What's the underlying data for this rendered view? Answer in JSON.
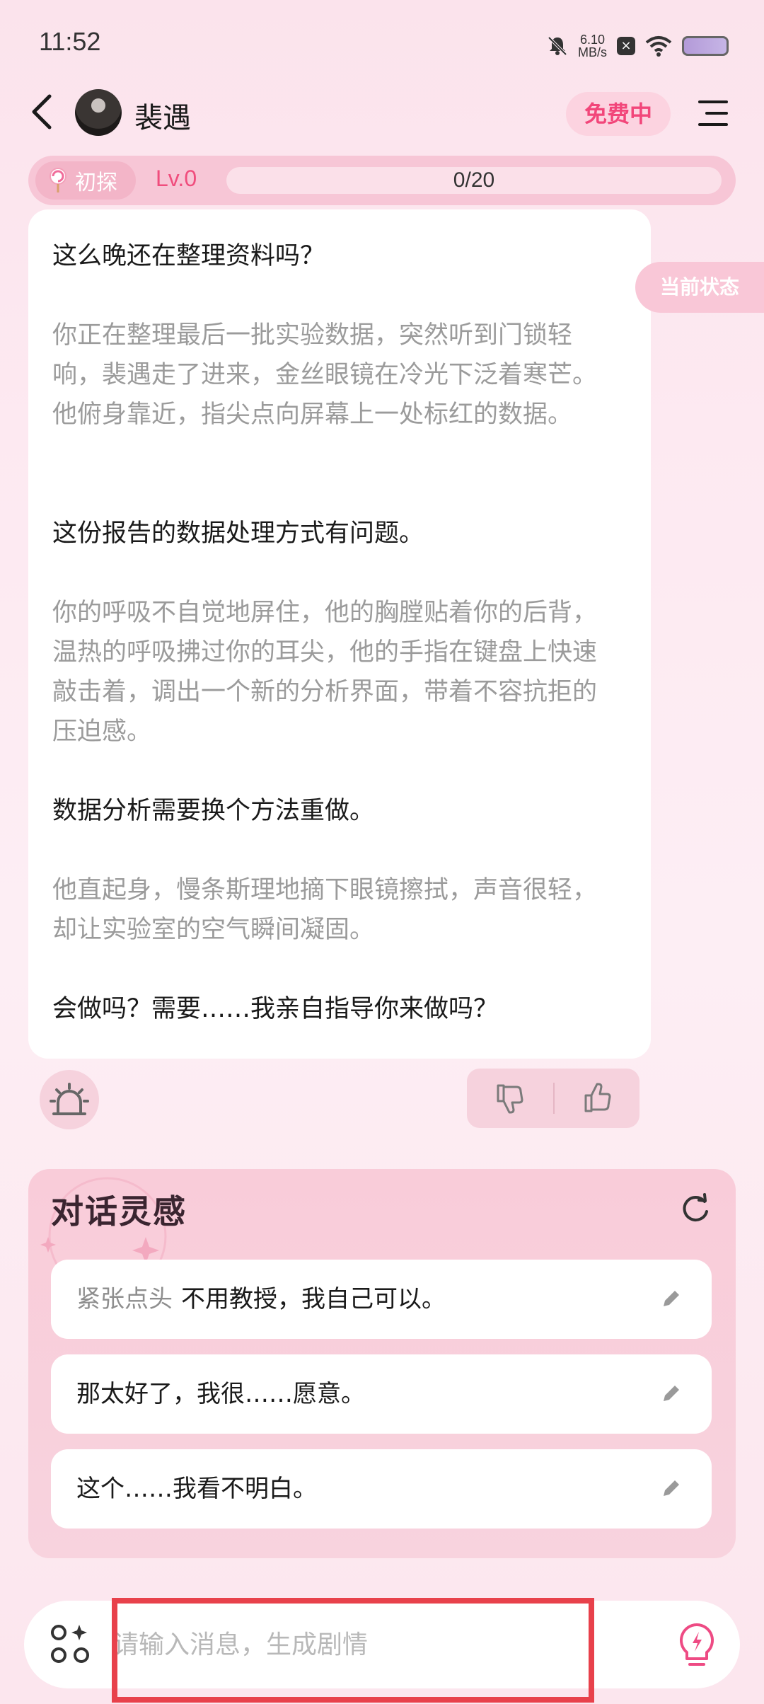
{
  "status_bar": {
    "time": "11:52",
    "speed_value": "6.10",
    "speed_unit": "MB/s",
    "icons": [
      "bell-muted-icon",
      "x-icon",
      "wifi-icon",
      "battery-icon"
    ]
  },
  "header": {
    "character_name": "裴遇",
    "badge": "免费中",
    "icons": [
      "back-icon",
      "avatar",
      "menu-icon"
    ]
  },
  "level": {
    "tag": "初探",
    "level_label": "Lv.0",
    "progress_text": "0/20",
    "progress": 0
  },
  "side_tab": {
    "label": "当前状态"
  },
  "message": {
    "paragraphs": [
      {
        "type": "speech",
        "text": "这么晚还在整理资料吗？"
      },
      {
        "type": "narration",
        "text": "你正在整理最后一批实验数据，突然听到门锁轻响，裴遇走了进来，金丝眼镜在冷光下泛着寒芒。他俯身靠近，指尖点向屏幕上一处标红的数据。"
      },
      {
        "type": "speech",
        "text": "这份报告的数据处理方式有问题。"
      },
      {
        "type": "narration",
        "text": "你的呼吸不自觉地屏住，他的胸膛贴着你的后背，温热的呼吸拂过你的耳尖，他的手指在键盘上快速敲击着，调出一个新的分析界面，带着不容抗拒的压迫感。"
      },
      {
        "type": "speech",
        "text": "数据分析需要换个方法重做。"
      },
      {
        "type": "narration",
        "text": "他直起身，慢条斯理地摘下眼镜擦拭，声音很轻，却让实验室的空气瞬间凝固。"
      },
      {
        "type": "speech",
        "text": "会做吗？需要……我亲自指导你来做吗？"
      }
    ]
  },
  "inspiration": {
    "title": "对话灵感",
    "suggestions": [
      {
        "action": "紧张点头",
        "text": "不用教授，我自己可以。"
      },
      {
        "action": "",
        "text": "那太好了，我很……愿意。"
      },
      {
        "action": "",
        "text": "这个……我看不明白。"
      }
    ]
  },
  "input": {
    "placeholder": "请输入消息，生成剧情"
  },
  "colors": {
    "accent_pink": "#f2467a",
    "highlight_red": "#e8414b",
    "bulb_pink": "#ee4b84"
  }
}
